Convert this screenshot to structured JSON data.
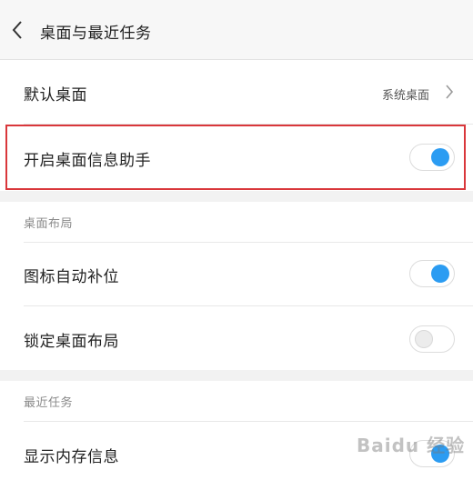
{
  "header": {
    "title": "桌面与最近任务",
    "back_icon": "chevron-left-icon"
  },
  "default_desktop": {
    "label": "默认桌面",
    "value": "系统桌面",
    "icon": "chevron-right-icon"
  },
  "desktop_assistant": {
    "label": "开启桌面信息助手",
    "enabled": true
  },
  "layout_section": {
    "title": "桌面布局",
    "items": [
      {
        "label": "图标自动补位",
        "enabled": true
      },
      {
        "label": "锁定桌面布局",
        "enabled": false
      }
    ]
  },
  "recent_section": {
    "title": "最近任务",
    "items": [
      {
        "label": "显示内存信息",
        "enabled": true
      }
    ]
  },
  "watermark": {
    "text": "Baidu 经验"
  },
  "colors": {
    "accent": "#2b9cf2",
    "highlight": "#d9373b",
    "section_gap": "#f2f2f2"
  }
}
